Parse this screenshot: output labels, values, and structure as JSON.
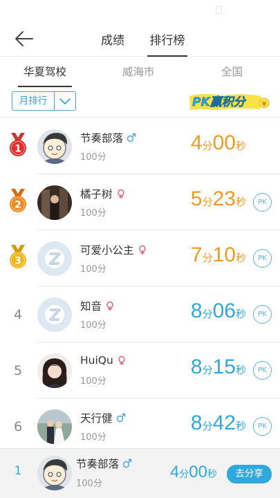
{
  "nav": {
    "back_icon": "back-arrow-icon",
    "tabs": [
      {
        "label": "成绩",
        "active": false
      },
      {
        "label": "排行榜",
        "active": true
      }
    ]
  },
  "scope_tabs": [
    {
      "label": "华夏驾校",
      "active": true
    },
    {
      "label": "威海市",
      "active": false
    },
    {
      "label": "全国",
      "active": false
    }
  ],
  "filter": {
    "selected": "月排行",
    "chevron_icon": "chevron-down-icon",
    "banner_text": "PK赢积分"
  },
  "rankings": [
    {
      "rank": "1",
      "medal": "gold-red",
      "name": "节奏部落",
      "gender": "male",
      "score": "100分",
      "min": "4",
      "min_unit": "分",
      "sec": "00",
      "sec_unit": "秒",
      "color": "#f19a22",
      "pk": ""
    },
    {
      "rank": "2",
      "medal": "orange",
      "name": "橘子树",
      "gender": "female",
      "score": "100分",
      "min": "5",
      "min_unit": "分",
      "sec": "23",
      "sec_unit": "秒",
      "color": "#f19a22",
      "pk": "PK"
    },
    {
      "rank": "3",
      "medal": "yellow",
      "name": "可爱小公主",
      "gender": "female",
      "score": "100分",
      "min": "7",
      "min_unit": "分",
      "sec": "10",
      "sec_unit": "秒",
      "color": "#f19a22",
      "pk": "PK"
    },
    {
      "rank": "4",
      "medal": "",
      "name": "知音",
      "gender": "female",
      "score": "100分",
      "min": "8",
      "min_unit": "分",
      "sec": "06",
      "sec_unit": "秒",
      "color": "#2fa8dc",
      "pk": "PK"
    },
    {
      "rank": "5",
      "medal": "",
      "name": "HuiQu",
      "gender": "female",
      "score": "100分",
      "min": "8",
      "min_unit": "分",
      "sec": "15",
      "sec_unit": "秒",
      "color": "#2fa8dc",
      "pk": "PK"
    },
    {
      "rank": "6",
      "medal": "",
      "name": "天行健",
      "gender": "male",
      "score": "100分",
      "min": "8",
      "min_unit": "分",
      "sec": "42",
      "sec_unit": "秒",
      "color": "#2fa8dc",
      "pk": "PK"
    }
  ],
  "me": {
    "rank": "1",
    "name": "节奏部落",
    "gender": "male",
    "score": "100分",
    "min": "4",
    "min_unit": "分",
    "sec": "00",
    "sec_unit": "秒",
    "share_label": "去分享"
  },
  "colors": {
    "accent": "#2fa8dc",
    "orange": "#f19a22",
    "male": "#4aa4dc",
    "female": "#e05a78"
  }
}
